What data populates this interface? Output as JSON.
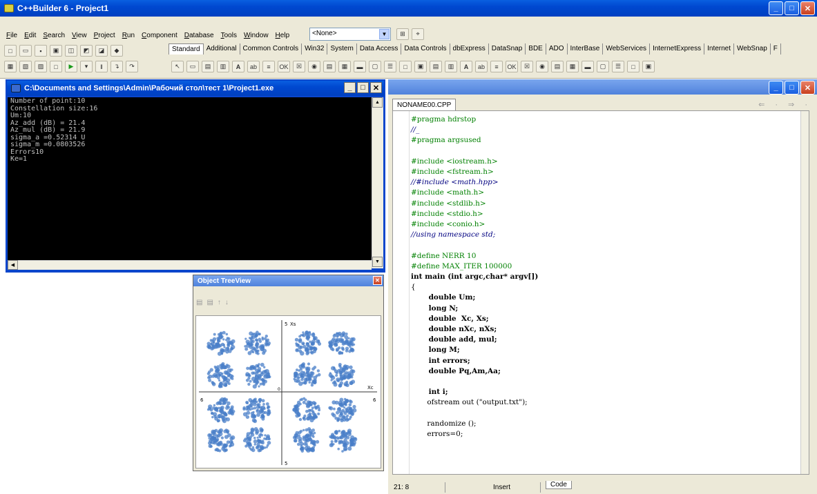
{
  "app": {
    "title": "C++Builder 6 - Project1"
  },
  "menu": [
    "File",
    "Edit",
    "Search",
    "View",
    "Project",
    "Run",
    "Component",
    "Database",
    "Tools",
    "Window",
    "Help"
  ],
  "combo_value": "<None>",
  "palette_tabs": [
    "Standard",
    "Additional",
    "Common Controls",
    "Win32",
    "System",
    "Data Access",
    "Data Controls",
    "dbExpress",
    "DataSnap",
    "BDE",
    "ADO",
    "InterBase",
    "WebServices",
    "InternetExpress",
    "Internet",
    "WebSnap",
    "F"
  ],
  "console": {
    "title": "C:\\Documents and Settings\\Admin\\Рабочий стол\\тест 1\\Project1.exe",
    "lines": [
      "Number of point:10",
      "Constellation size:16",
      "Um:10",
      "Az_add (dB) = 21.4",
      "Az_mul (dB) = 21.9",
      "sigma_a =0.52314 U",
      "sigma_m =0.0803526",
      "Errors10",
      "Ke=1"
    ]
  },
  "tree": {
    "title": "Object TreeView",
    "tools": [
      "▤",
      "▤",
      "↑",
      "↓"
    ],
    "plot_labels": {
      "y_top": "5",
      "y_bottom": "5",
      "x_left": "6",
      "x_right": "6",
      "x_axis": "Xc",
      "y_axis": "Xs",
      "y_mid": "0"
    }
  },
  "editor": {
    "tab": "NONAME00.CPP",
    "nav": "⇐ · ⇒ ·",
    "status": {
      "position": "21:  8",
      "mode": "Insert",
      "tab": "Code"
    },
    "code": [
      {
        "t": "#pragma hdrstop",
        "c": "pre"
      },
      {
        "t": "//_",
        "c": "com"
      },
      {
        "t": "#pragma argsused",
        "c": "pre"
      },
      {
        "t": "",
        "c": ""
      },
      {
        "t": "#include <iostream.h>",
        "c": "pre"
      },
      {
        "t": "#include <fstream.h>",
        "c": "pre"
      },
      {
        "t": "//#include <math.hpp>",
        "c": "com"
      },
      {
        "t": "#include <math.h>",
        "c": "pre"
      },
      {
        "t": "#include <stdlib.h>",
        "c": "pre"
      },
      {
        "t": "#include <stdio.h>",
        "c": "pre"
      },
      {
        "t": "#include <conio.h>",
        "c": "pre"
      },
      {
        "t": "//using namespace std;",
        "c": "com"
      },
      {
        "t": "",
        "c": ""
      },
      {
        "t": "#define NERR 10",
        "c": "pre"
      },
      {
        "t": "#define MAX_ITER 100000",
        "c": "pre"
      },
      {
        "t": "int main (int argc,char* argv[])",
        "c": "kw"
      },
      {
        "t": "{",
        "c": ""
      },
      {
        "t": "       double Um;",
        "c": "kw"
      },
      {
        "t": "       long N;",
        "c": "kw"
      },
      {
        "t": "       double  Xc, Xs;",
        "c": "kw"
      },
      {
        "t": "       double nXc, nXs;",
        "c": "kw"
      },
      {
        "t": "       double add, mul;",
        "c": "kw"
      },
      {
        "t": "       long M;",
        "c": "kw"
      },
      {
        "t": "       int errors;",
        "c": "kw"
      },
      {
        "t": "       double Pq,Am,Aa;",
        "c": "kw"
      },
      {
        "t": "",
        "c": ""
      },
      {
        "t": "       int i;",
        "c": "kw"
      },
      {
        "t": "       ofstream out (\"output.txt\");",
        "c": ""
      },
      {
        "t": "",
        "c": ""
      },
      {
        "t": "       randomize ();",
        "c": ""
      },
      {
        "t": "       errors=0;",
        "c": ""
      }
    ]
  },
  "colors": {
    "titlebar": "#0048d0",
    "console_bg": "#000000",
    "cluster": "#4a7fc8"
  }
}
